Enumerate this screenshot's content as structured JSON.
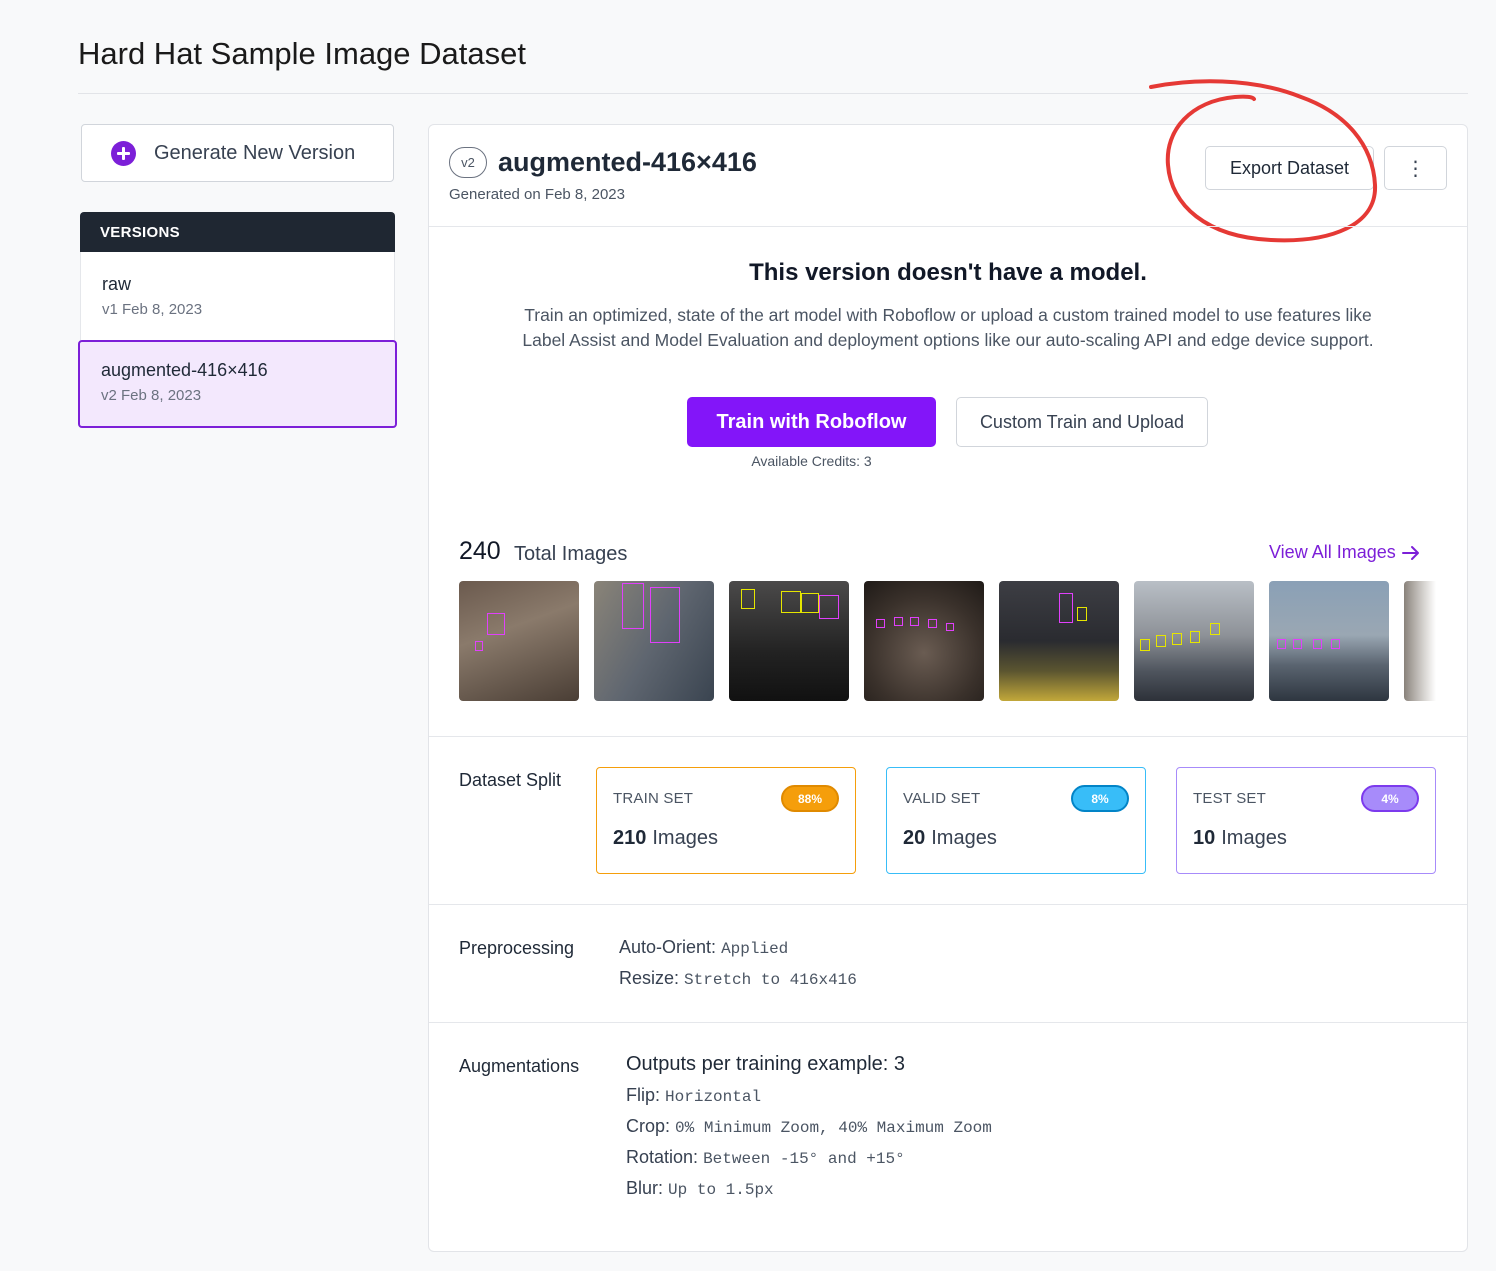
{
  "page": {
    "title": "Hard Hat Sample Image Dataset"
  },
  "sidebar": {
    "generate_label": "Generate New Version",
    "versions_header": "VERSIONS",
    "versions": [
      {
        "name": "raw",
        "meta": "v1 Feb 8, 2023",
        "active": false
      },
      {
        "name": "augmented-416×416",
        "meta": "v2 Feb 8, 2023",
        "active": true
      }
    ]
  },
  "version": {
    "badge": "v2",
    "title": "augmented-416×416",
    "generated": "Generated on Feb 8, 2023",
    "export_label": "Export Dataset",
    "more_label": "⋮"
  },
  "model": {
    "title": "This version doesn't have a model.",
    "description": "Train an optimized, state of the art model with Roboflow or upload a custom trained model to use features like Label Assist and Model Evaluation and deployment options like our auto-scaling API and edge device support.",
    "train_label": "Train with Roboflow",
    "custom_label": "Custom Train and Upload",
    "credits": "Available Credits:  3"
  },
  "images": {
    "count": "240",
    "label": "Total Images",
    "view_all": "View All Images"
  },
  "split": {
    "label": "Dataset Split",
    "sets": [
      {
        "name": "TRAIN SET",
        "pct": "88%",
        "count": "210",
        "unit": "Images",
        "color": "#f59e0b"
      },
      {
        "name": "VALID SET",
        "pct": "8%",
        "count": "20",
        "unit": "Images",
        "color": "#38bdf8"
      },
      {
        "name": "TEST SET",
        "pct": "4%",
        "count": "10",
        "unit": "Images",
        "color": "#a78bfa"
      }
    ]
  },
  "preprocessing": {
    "label": "Preprocessing",
    "items": [
      {
        "key": "Auto-Orient:",
        "value": "Applied"
      },
      {
        "key": "Resize:",
        "value": "Stretch to 416x416"
      }
    ]
  },
  "augmentations": {
    "label": "Augmentations",
    "title": "Outputs per training example: 3",
    "items": [
      {
        "key": "Flip:",
        "value": "Horizontal"
      },
      {
        "key": "Crop:",
        "value": "0% Minimum Zoom, 40% Maximum Zoom"
      },
      {
        "key": "Rotation:",
        "value": "Between -15° and +15°"
      },
      {
        "key": "Blur:",
        "value": "Up to 1.5px"
      }
    ]
  },
  "colors": {
    "accent": "#8315f9",
    "annotation": "#e53935"
  }
}
